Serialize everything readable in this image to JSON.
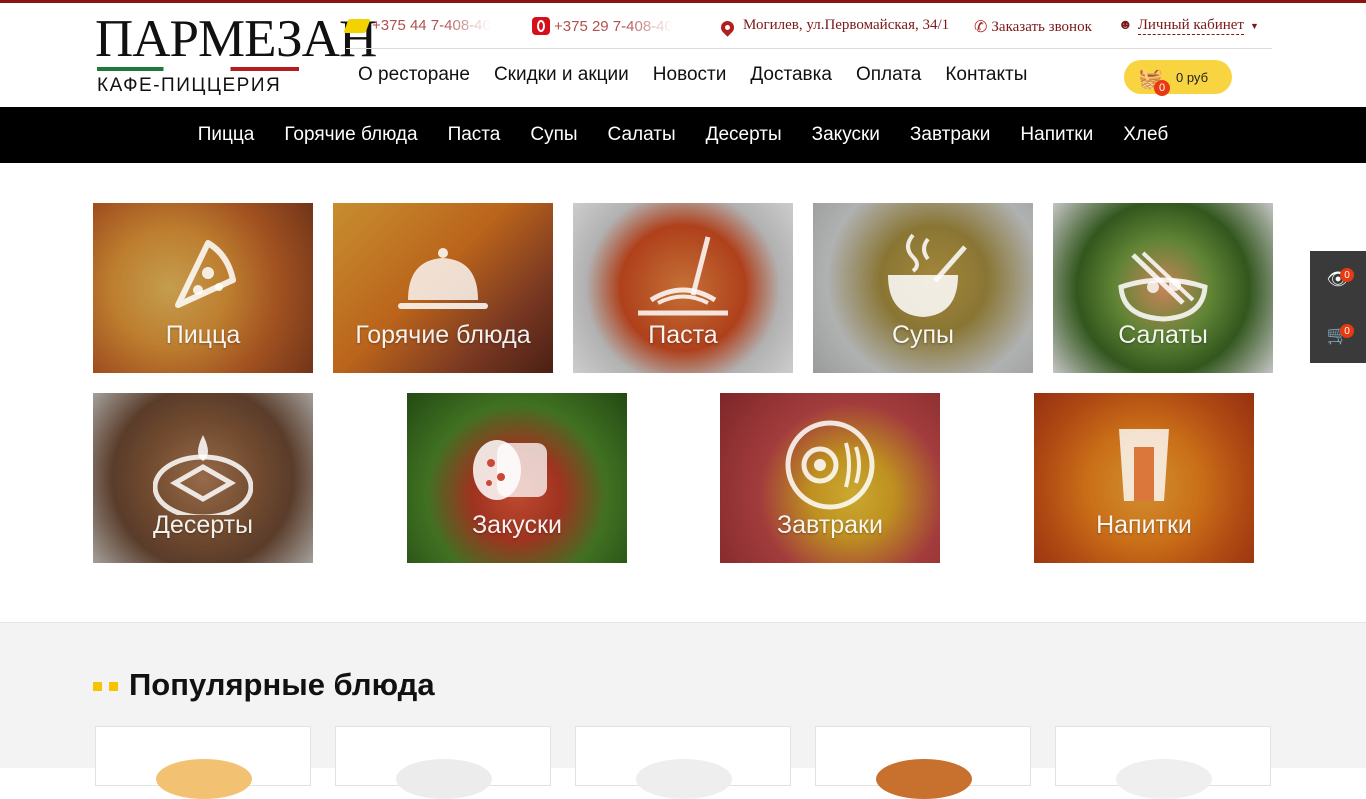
{
  "brand": {
    "name": "ПАРМЕЗАН",
    "subtitle": "КАФЕ-ПИЦЦЕРИЯ"
  },
  "contacts": {
    "phone1": "+375 44 7-408-40",
    "phone2": "+375 29 7-408-40",
    "address": "Могилев, ул.Первомайская, 34/1",
    "callback": "Заказать звонок",
    "cabinet": "Личный кабинет"
  },
  "top_nav": [
    "О ресторане",
    "Скидки и акции",
    "Новости",
    "Доставка",
    "Оплата",
    "Контакты"
  ],
  "cart": {
    "count": "0",
    "sum": "0 руб"
  },
  "main_menu": [
    "Пицца",
    "Горячие блюда",
    "Паста",
    "Супы",
    "Салаты",
    "Десерты",
    "Закуски",
    "Завтраки",
    "Напитки",
    "Хлеб"
  ],
  "categories": [
    {
      "label": "Пицца",
      "icon": "pizza-slice-icon"
    },
    {
      "label": "Горячие блюда",
      "icon": "cloche-icon"
    },
    {
      "label": "Паста",
      "icon": "pasta-fork-icon"
    },
    {
      "label": "Супы",
      "icon": "soup-bowl-icon"
    },
    {
      "label": "Салаты",
      "icon": "salad-bowl-icon"
    },
    {
      "label": "Десерты",
      "icon": "cake-slice-icon"
    },
    {
      "label": "Закуски",
      "icon": "sausage-icon"
    },
    {
      "label": "Завтраки",
      "icon": "plate-egg-icon"
    },
    {
      "label": "Напитки",
      "icon": "glass-icon"
    }
  ],
  "side_panel": {
    "viewed_count": "0",
    "cart_count": "0"
  },
  "popular": {
    "title": "Популярные блюда"
  },
  "colors": {
    "accent_dark": "#7b1a1a",
    "menubar": "#000000",
    "cart": "#f9d441",
    "badge": "#e83a12",
    "dots": "#f6c400"
  }
}
